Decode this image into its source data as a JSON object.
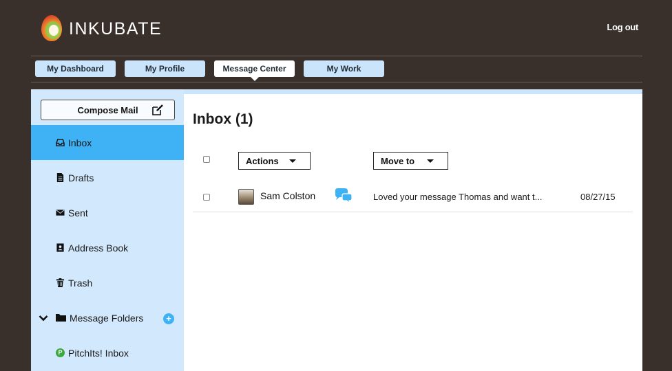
{
  "app": {
    "brand": "INKUBATE",
    "logout_label": "Log out"
  },
  "tabs": [
    {
      "label": "My Dashboard",
      "active": false
    },
    {
      "label": "My Profile",
      "active": false
    },
    {
      "label": "Message Center",
      "active": true
    },
    {
      "label": "My Work",
      "active": false
    }
  ],
  "sidebar": {
    "compose_label": "Compose Mail",
    "items": [
      {
        "label": "Inbox",
        "icon": "inbox-icon",
        "active": true
      },
      {
        "label": "Drafts",
        "icon": "document-icon"
      },
      {
        "label": "Sent",
        "icon": "envelope-icon"
      },
      {
        "label": "Address Book",
        "icon": "address-book-icon"
      },
      {
        "label": "Trash",
        "icon": "trash-icon"
      },
      {
        "label": "Message Folders",
        "icon": "folder-icon"
      },
      {
        "label": "PitchIts! Inbox",
        "icon": "p-badge-icon",
        "badge": "P"
      }
    ]
  },
  "main": {
    "title": "Inbox (1)",
    "actions_label": "Actions",
    "move_to_label": "Move to",
    "messages": [
      {
        "sender": "Sam Colston",
        "snippet": "Loved your message Thomas and want t...",
        "date": "08/27/15"
      }
    ]
  },
  "colors": {
    "background": "#3a302b",
    "tab": "#c9e4fb",
    "sidebar": "#d2e8fd",
    "active": "#3fb1f5"
  }
}
